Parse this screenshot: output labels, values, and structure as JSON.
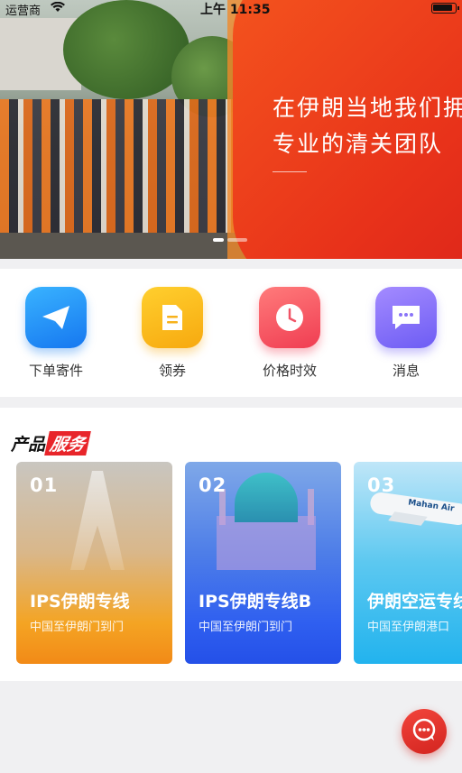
{
  "status_bar": {
    "carrier": "运营商",
    "time": "上午 11:35"
  },
  "banner": {
    "headline_line1": "在伊朗当地我们拥有",
    "headline_line2": "专业的清关团队",
    "slide_count": 2,
    "active_slide": 1
  },
  "quick_actions": [
    {
      "label": "下单寄件",
      "icon": "paper-plane-icon",
      "color": "#1677f0"
    },
    {
      "label": "领券",
      "icon": "coupon-icon",
      "color": "#f7a90f"
    },
    {
      "label": "价格时效",
      "icon": "clock-icon",
      "color": "#f03d52"
    },
    {
      "label": "消息",
      "icon": "message-icon",
      "color": "#6d5cf4"
    }
  ],
  "products": {
    "title_part1": "产品",
    "title_part2": "服务",
    "cards": [
      {
        "num": "01",
        "name": "IPS伊朗专线",
        "sub": "中国至伊朗门到门"
      },
      {
        "num": "02",
        "name": "IPS伊朗专线B",
        "sub": "中国至伊朗门到门"
      },
      {
        "num": "03",
        "name": "伊朗空运专线",
        "sub": "中国至伊朗港口",
        "airline": "Mahan Air"
      }
    ]
  },
  "fab": {
    "icon": "customer-service-icon"
  },
  "colors": {
    "brand_red": "#e8252a"
  }
}
